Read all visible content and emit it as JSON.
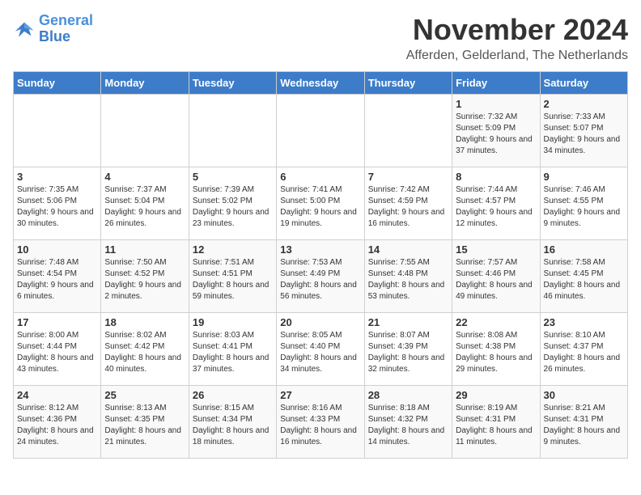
{
  "header": {
    "logo_line1": "General",
    "logo_line2": "Blue",
    "month": "November 2024",
    "location": "Afferden, Gelderland, The Netherlands"
  },
  "weekdays": [
    "Sunday",
    "Monday",
    "Tuesday",
    "Wednesday",
    "Thursday",
    "Friday",
    "Saturday"
  ],
  "weeks": [
    [
      {
        "day": "",
        "info": ""
      },
      {
        "day": "",
        "info": ""
      },
      {
        "day": "",
        "info": ""
      },
      {
        "day": "",
        "info": ""
      },
      {
        "day": "",
        "info": ""
      },
      {
        "day": "1",
        "info": "Sunrise: 7:32 AM\nSunset: 5:09 PM\nDaylight: 9 hours and 37 minutes."
      },
      {
        "day": "2",
        "info": "Sunrise: 7:33 AM\nSunset: 5:07 PM\nDaylight: 9 hours and 34 minutes."
      }
    ],
    [
      {
        "day": "3",
        "info": "Sunrise: 7:35 AM\nSunset: 5:06 PM\nDaylight: 9 hours and 30 minutes."
      },
      {
        "day": "4",
        "info": "Sunrise: 7:37 AM\nSunset: 5:04 PM\nDaylight: 9 hours and 26 minutes."
      },
      {
        "day": "5",
        "info": "Sunrise: 7:39 AM\nSunset: 5:02 PM\nDaylight: 9 hours and 23 minutes."
      },
      {
        "day": "6",
        "info": "Sunrise: 7:41 AM\nSunset: 5:00 PM\nDaylight: 9 hours and 19 minutes."
      },
      {
        "day": "7",
        "info": "Sunrise: 7:42 AM\nSunset: 4:59 PM\nDaylight: 9 hours and 16 minutes."
      },
      {
        "day": "8",
        "info": "Sunrise: 7:44 AM\nSunset: 4:57 PM\nDaylight: 9 hours and 12 minutes."
      },
      {
        "day": "9",
        "info": "Sunrise: 7:46 AM\nSunset: 4:55 PM\nDaylight: 9 hours and 9 minutes."
      }
    ],
    [
      {
        "day": "10",
        "info": "Sunrise: 7:48 AM\nSunset: 4:54 PM\nDaylight: 9 hours and 6 minutes."
      },
      {
        "day": "11",
        "info": "Sunrise: 7:50 AM\nSunset: 4:52 PM\nDaylight: 9 hours and 2 minutes."
      },
      {
        "day": "12",
        "info": "Sunrise: 7:51 AM\nSunset: 4:51 PM\nDaylight: 8 hours and 59 minutes."
      },
      {
        "day": "13",
        "info": "Sunrise: 7:53 AM\nSunset: 4:49 PM\nDaylight: 8 hours and 56 minutes."
      },
      {
        "day": "14",
        "info": "Sunrise: 7:55 AM\nSunset: 4:48 PM\nDaylight: 8 hours and 53 minutes."
      },
      {
        "day": "15",
        "info": "Sunrise: 7:57 AM\nSunset: 4:46 PM\nDaylight: 8 hours and 49 minutes."
      },
      {
        "day": "16",
        "info": "Sunrise: 7:58 AM\nSunset: 4:45 PM\nDaylight: 8 hours and 46 minutes."
      }
    ],
    [
      {
        "day": "17",
        "info": "Sunrise: 8:00 AM\nSunset: 4:44 PM\nDaylight: 8 hours and 43 minutes."
      },
      {
        "day": "18",
        "info": "Sunrise: 8:02 AM\nSunset: 4:42 PM\nDaylight: 8 hours and 40 minutes."
      },
      {
        "day": "19",
        "info": "Sunrise: 8:03 AM\nSunset: 4:41 PM\nDaylight: 8 hours and 37 minutes."
      },
      {
        "day": "20",
        "info": "Sunrise: 8:05 AM\nSunset: 4:40 PM\nDaylight: 8 hours and 34 minutes."
      },
      {
        "day": "21",
        "info": "Sunrise: 8:07 AM\nSunset: 4:39 PM\nDaylight: 8 hours and 32 minutes."
      },
      {
        "day": "22",
        "info": "Sunrise: 8:08 AM\nSunset: 4:38 PM\nDaylight: 8 hours and 29 minutes."
      },
      {
        "day": "23",
        "info": "Sunrise: 8:10 AM\nSunset: 4:37 PM\nDaylight: 8 hours and 26 minutes."
      }
    ],
    [
      {
        "day": "24",
        "info": "Sunrise: 8:12 AM\nSunset: 4:36 PM\nDaylight: 8 hours and 24 minutes."
      },
      {
        "day": "25",
        "info": "Sunrise: 8:13 AM\nSunset: 4:35 PM\nDaylight: 8 hours and 21 minutes."
      },
      {
        "day": "26",
        "info": "Sunrise: 8:15 AM\nSunset: 4:34 PM\nDaylight: 8 hours and 18 minutes."
      },
      {
        "day": "27",
        "info": "Sunrise: 8:16 AM\nSunset: 4:33 PM\nDaylight: 8 hours and 16 minutes."
      },
      {
        "day": "28",
        "info": "Sunrise: 8:18 AM\nSunset: 4:32 PM\nDaylight: 8 hours and 14 minutes."
      },
      {
        "day": "29",
        "info": "Sunrise: 8:19 AM\nSunset: 4:31 PM\nDaylight: 8 hours and 11 minutes."
      },
      {
        "day": "30",
        "info": "Sunrise: 8:21 AM\nSunset: 4:31 PM\nDaylight: 8 hours and 9 minutes."
      }
    ]
  ]
}
